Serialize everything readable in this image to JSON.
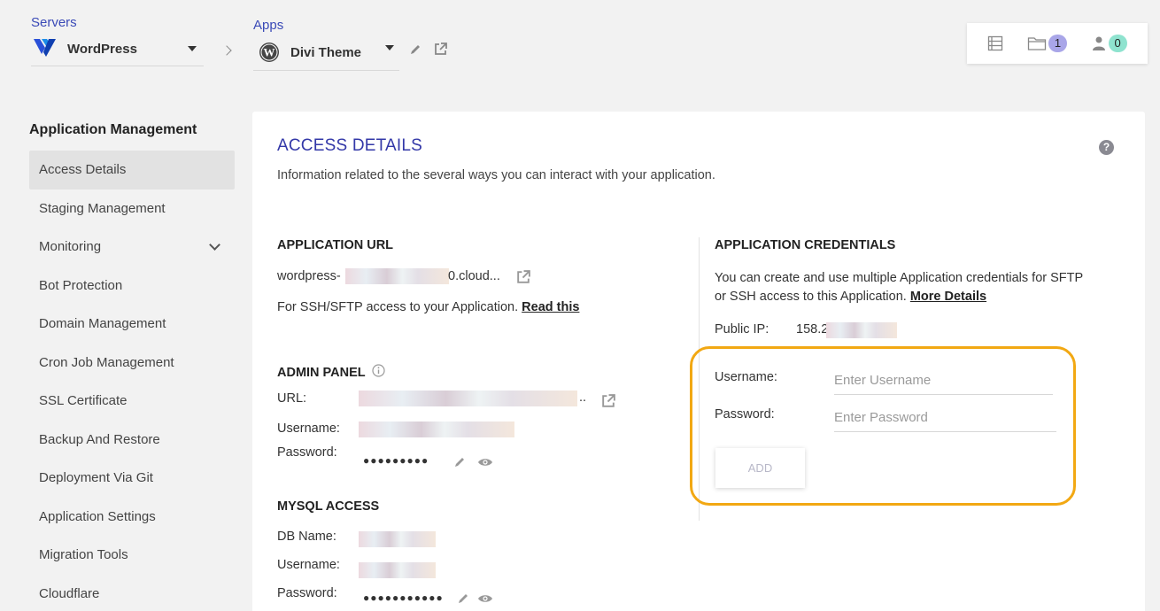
{
  "header": {
    "servers_label": "Servers",
    "server_name": "WordPress",
    "apps_label": "Apps",
    "app_name": "Divi Theme",
    "badges": {
      "files_count": "1",
      "users_count": "0"
    }
  },
  "sidebar": {
    "title": "Application Management",
    "items": [
      {
        "label": "Access Details",
        "active": true
      },
      {
        "label": "Staging Management"
      },
      {
        "label": "Monitoring",
        "expandable": true
      },
      {
        "label": "Bot Protection"
      },
      {
        "label": "Domain Management"
      },
      {
        "label": "Cron Job Management"
      },
      {
        "label": "SSL Certificate"
      },
      {
        "label": "Backup And Restore"
      },
      {
        "label": "Deployment Via Git"
      },
      {
        "label": "Application Settings"
      },
      {
        "label": "Migration Tools"
      },
      {
        "label": "Cloudflare"
      }
    ]
  },
  "main": {
    "title": "ACCESS DETAILS",
    "subtitle": "Information related to the several ways you can interact with your application.",
    "help": "?",
    "app_url": {
      "heading": "APPLICATION URL",
      "url_prefix": "wordpress-",
      "url_suffix": "0.cloud...",
      "ssh_text": "For SSH/SFTP access to your Application.",
      "read_link": "Read this"
    },
    "admin_panel": {
      "heading": "ADMIN PANEL",
      "url_label": "URL:",
      "url_trail": "..",
      "username_label": "Username:",
      "password_label": "Password:",
      "password_mask": "●●●●●●●●●"
    },
    "mysql": {
      "heading": "MYSQL ACCESS",
      "db_label": "DB Name:",
      "username_label": "Username:",
      "password_label": "Password:",
      "password_mask": "●●●●●●●●●●●"
    },
    "credentials": {
      "heading": "APPLICATION CREDENTIALS",
      "desc_line1": "You can create and use multiple Application credentials for SFTP",
      "desc_line2": "or SSH access to this Application.",
      "more_link": "More Details",
      "public_ip_label": "Public IP:",
      "public_ip_value": "158.2",
      "username_label": "Username:",
      "username_placeholder": "Enter Username",
      "password_label": "Password:",
      "password_placeholder": "Enter Password",
      "add_button": "ADD"
    }
  },
  "colors": {
    "accent": "#3338a8",
    "highlight_border": "#f2a813",
    "badge_purple": "#a9a6e8",
    "badge_teal": "#8fe3cf"
  }
}
